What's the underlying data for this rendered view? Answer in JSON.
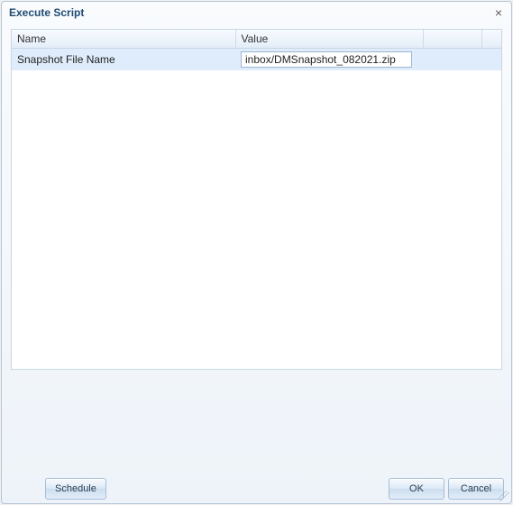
{
  "dialog": {
    "title": "Execute Script"
  },
  "table": {
    "headers": {
      "name": "Name",
      "value": "Value"
    },
    "rows": [
      {
        "name": "Snapshot File Name",
        "value": "inbox/DMSnapshot_082021.zip"
      }
    ]
  },
  "buttons": {
    "schedule": "Schedule",
    "ok": "OK",
    "cancel": "Cancel"
  }
}
